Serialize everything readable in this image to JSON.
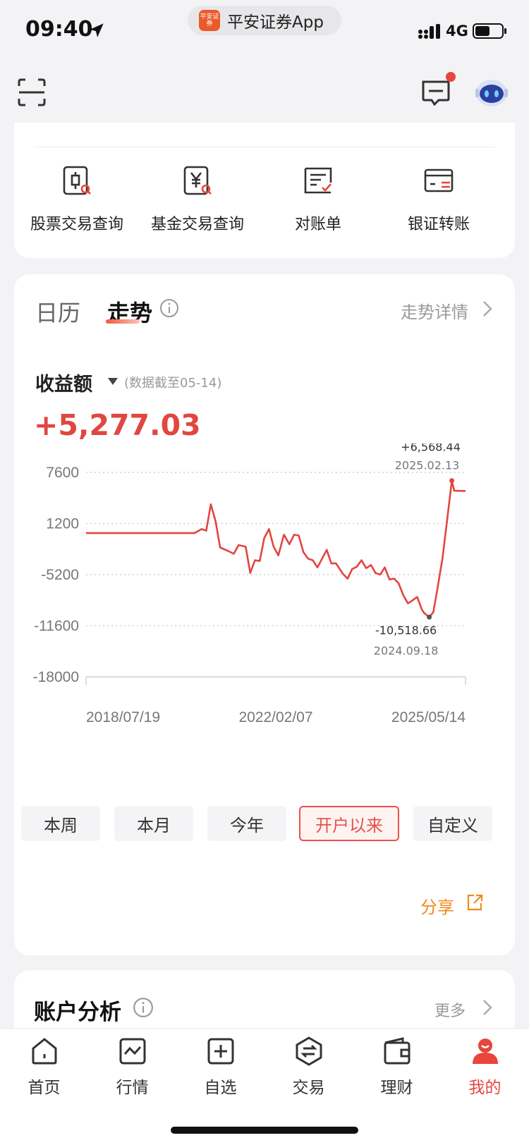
{
  "status_bar": {
    "time": "09:40",
    "app_name": "平安证券App",
    "app_logo_text": "平安证券",
    "network": "4G"
  },
  "tools": [
    {
      "label": "股票交易查询",
      "icon": "stock-query-icon"
    },
    {
      "label": "基金交易查询",
      "icon": "fund-query-icon"
    },
    {
      "label": "对账单",
      "icon": "statement-icon"
    },
    {
      "label": "银证转账",
      "icon": "bank-transfer-icon"
    }
  ],
  "trend_card": {
    "tab_calendar": "日历",
    "tab_trend": "走势",
    "detail_link": "走势详情",
    "metric_label": "收益额",
    "as_of": "(数据截至05-14)",
    "total_value": "+5,277.03",
    "accent_color": "#e14640",
    "ranges": [
      "本周",
      "本月",
      "今年",
      "开户以来",
      "自定义"
    ],
    "active_range": "开户以来",
    "share_label": "分享"
  },
  "chart_data": {
    "type": "line",
    "ylim": [
      -18000,
      7600
    ],
    "y_ticks": [
      "7600",
      "1200",
      "-5200",
      "-11600",
      "-18000"
    ],
    "x_ticks": [
      "2018/07/19",
      "2022/02/07",
      "2025/05/14"
    ],
    "grid": true,
    "series": [
      {
        "values": [
          [
            "2018-07-19",
            0
          ],
          [
            "2019-03-01",
            0
          ],
          [
            "2019-09-01",
            0
          ],
          [
            "2020-01-01",
            0
          ],
          [
            "2020-07-01",
            0
          ],
          [
            "2020-08-15",
            500
          ],
          [
            "2020-09-15",
            300
          ],
          [
            "2020-10-15",
            3600
          ],
          [
            "2020-11-15",
            1500
          ],
          [
            "2020-12-15",
            -1800
          ],
          [
            "2021-02-01",
            -2200
          ],
          [
            "2021-03-15",
            -2600
          ],
          [
            "2021-04-15",
            -1500
          ],
          [
            "2021-06-01",
            -1700
          ],
          [
            "2021-07-01",
            -5000
          ],
          [
            "2021-08-01",
            -3400
          ],
          [
            "2021-09-01",
            -3500
          ],
          [
            "2021-10-01",
            -600
          ],
          [
            "2021-11-01",
            500
          ],
          [
            "2021-12-01",
            -1700
          ],
          [
            "2022-01-01",
            -2800
          ],
          [
            "2022-02-07",
            -200
          ],
          [
            "2022-03-15",
            -1400
          ],
          [
            "2022-04-15",
            -200
          ],
          [
            "2022-05-15",
            -300
          ],
          [
            "2022-06-15",
            -2400
          ],
          [
            "2022-07-15",
            -3200
          ],
          [
            "2022-08-15",
            -3400
          ],
          [
            "2022-09-15",
            -4300
          ],
          [
            "2022-11-15",
            -2100
          ],
          [
            "2022-12-15",
            -3800
          ],
          [
            "2023-01-15",
            -3800
          ],
          [
            "2023-03-01",
            -5100
          ],
          [
            "2023-04-01",
            -5700
          ],
          [
            "2023-05-01",
            -4500
          ],
          [
            "2023-06-01",
            -4200
          ],
          [
            "2023-07-01",
            -3400
          ],
          [
            "2023-08-01",
            -4400
          ],
          [
            "2023-09-01",
            -4000
          ],
          [
            "2023-10-01",
            -5000
          ],
          [
            "2023-11-01",
            -5200
          ],
          [
            "2023-12-01",
            -4300
          ],
          [
            "2024-01-01",
            -5800
          ],
          [
            "2024-02-01",
            -5700
          ],
          [
            "2024-03-01",
            -6300
          ],
          [
            "2024-04-01",
            -7800
          ],
          [
            "2024-05-01",
            -8800
          ],
          [
            "2024-06-01",
            -8400
          ],
          [
            "2024-07-01",
            -8000
          ],
          [
            "2024-08-01",
            -9600
          ],
          [
            "2024-08-15",
            -10000
          ],
          [
            "2024-09-18",
            -10518.66
          ],
          [
            "2024-10-15",
            -9900
          ],
          [
            "2024-11-15",
            -6500
          ],
          [
            "2024-12-15",
            -3000
          ],
          [
            "2025-02-13",
            6568.44
          ],
          [
            "2025-03-01",
            5300
          ],
          [
            "2025-05-14",
            5277.03
          ]
        ]
      }
    ],
    "annotations": [
      {
        "value": "+6,568.44",
        "date": "2025.02.13"
      },
      {
        "value": "-10,518.66",
        "date": "2024.09.18"
      }
    ]
  },
  "analysis_card": {
    "title": "账户分析",
    "more_label": "更多"
  },
  "tabbar": [
    {
      "label": "首页",
      "icon": "home-icon"
    },
    {
      "label": "行情",
      "icon": "market-icon"
    },
    {
      "label": "自选",
      "icon": "watchlist-icon"
    },
    {
      "label": "交易",
      "icon": "trade-icon"
    },
    {
      "label": "理财",
      "icon": "wealth-icon"
    },
    {
      "label": "我的",
      "icon": "profile-icon"
    }
  ],
  "active_tab": "我的"
}
